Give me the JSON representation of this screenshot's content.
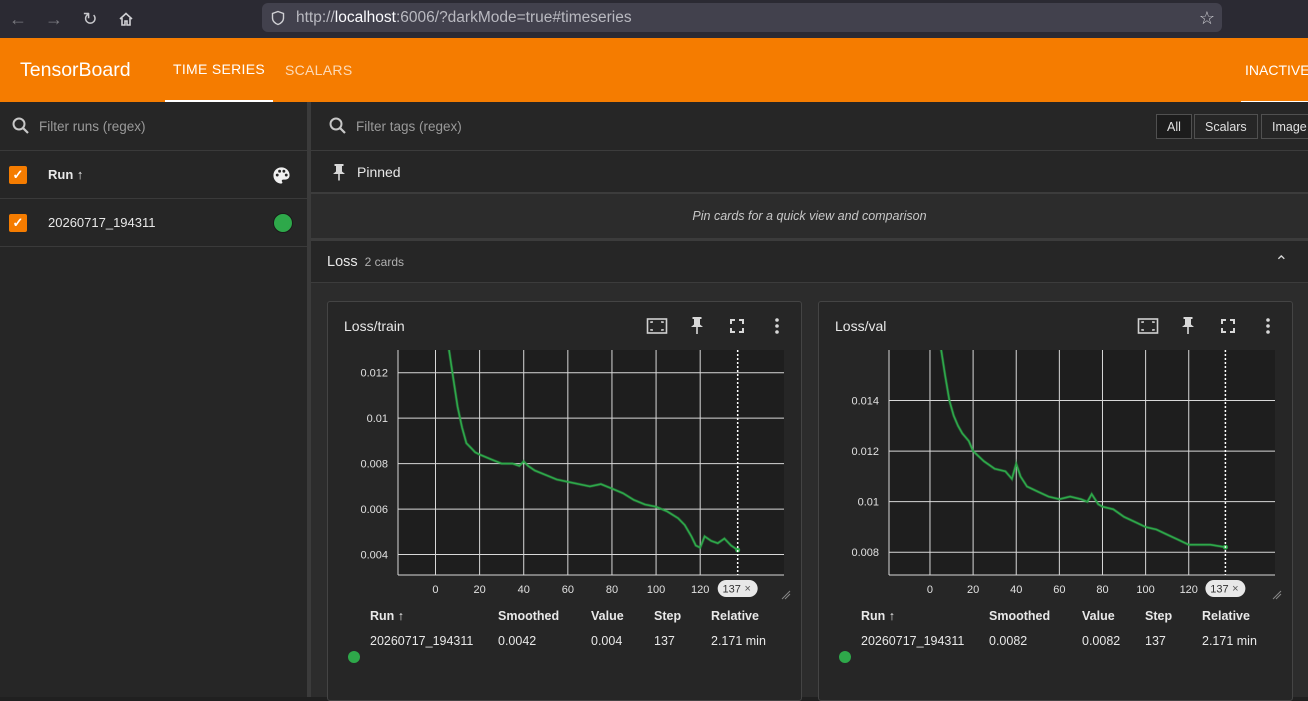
{
  "browser": {
    "url_scheme": "http://",
    "url_host": "localhost",
    "url_rest": ":6006/?darkMode=true#timeseries"
  },
  "header": {
    "logo": "TensorBoard",
    "tabs": [
      "TIME SERIES",
      "SCALARS"
    ],
    "status": "INACTIVE"
  },
  "sidebar": {
    "filter_placeholder": "Filter runs (regex)",
    "run_column": "Run ↑",
    "runs": [
      {
        "name": "20260717_194311",
        "color": "#2ea84a"
      }
    ]
  },
  "main": {
    "filter_placeholder": "Filter tags (regex)",
    "type_buttons": [
      "All",
      "Scalars",
      "Image"
    ],
    "pinned_title": "Pinned",
    "pinned_empty": "Pin cards for a quick view and comparison",
    "group_title": "Loss",
    "group_count": "2 cards"
  },
  "table_headers": {
    "run": "Run ↑",
    "smoothed": "Smoothed",
    "value": "Value",
    "step": "Step",
    "relative": "Relative"
  },
  "cards": [
    {
      "title": "Loss/train",
      "run": "20260717_194311",
      "smoothed": "0.0042",
      "value": "0.004",
      "step": "137",
      "relative": "2.171 min"
    },
    {
      "title": "Loss/val",
      "run": "20260717_194311",
      "smoothed": "0.0082",
      "value": "0.0082",
      "step": "137",
      "relative": "2.171 min"
    }
  ],
  "chart_data": [
    {
      "type": "line",
      "title": "Loss/train",
      "xlabel": "",
      "ylabel": "",
      "x_ticks": [
        "0",
        "20",
        "40",
        "60",
        "80",
        "100",
        "120"
      ],
      "y_ticks": [
        "0.004",
        "0.006",
        "0.008",
        "0.01",
        "0.012"
      ],
      "xlim": [
        -17,
        158
      ],
      "ylim": [
        0.0031,
        0.013
      ],
      "cursor_step": "137",
      "grid": true,
      "series": [
        {
          "name": "20260717_194311",
          "color": "#2ea84a",
          "x": [
            6,
            8,
            10,
            12,
            14,
            16,
            18,
            20,
            25,
            30,
            35,
            38,
            40,
            42,
            45,
            50,
            55,
            60,
            65,
            70,
            75,
            80,
            85,
            90,
            95,
            100,
            105,
            110,
            113,
            116,
            118,
            120,
            122,
            125,
            128,
            131,
            134,
            137
          ],
          "y": [
            0.0131,
            0.0118,
            0.0105,
            0.0096,
            0.0089,
            0.0087,
            0.0085,
            0.0084,
            0.0082,
            0.008,
            0.008,
            0.0079,
            0.0081,
            0.0079,
            0.0077,
            0.0075,
            0.0073,
            0.0072,
            0.0071,
            0.007,
            0.0071,
            0.0069,
            0.0067,
            0.0064,
            0.0062,
            0.0061,
            0.0059,
            0.0056,
            0.0053,
            0.0048,
            0.0044,
            0.0043,
            0.0048,
            0.0046,
            0.0045,
            0.0047,
            0.0044,
            0.0042
          ]
        }
      ]
    },
    {
      "type": "line",
      "title": "Loss/val",
      "xlabel": "",
      "ylabel": "",
      "x_ticks": [
        "0",
        "20",
        "40",
        "60",
        "80",
        "100",
        "120"
      ],
      "y_ticks": [
        "0.008",
        "0.01",
        "0.012",
        "0.014"
      ],
      "xlim": [
        -19,
        160
      ],
      "ylim": [
        0.0071,
        0.016
      ],
      "cursor_step": "137",
      "grid": true,
      "series": [
        {
          "name": "20260717_194311",
          "color": "#2ea84a",
          "x": [
            5,
            7,
            9,
            11,
            13,
            15,
            18,
            20,
            25,
            30,
            35,
            38,
            40,
            42,
            45,
            50,
            55,
            60,
            65,
            70,
            73,
            75,
            78,
            80,
            85,
            90,
            95,
            100,
            105,
            110,
            115,
            120,
            125,
            130,
            137
          ],
          "y": [
            0.0161,
            0.015,
            0.014,
            0.0134,
            0.013,
            0.0127,
            0.0124,
            0.012,
            0.0116,
            0.0113,
            0.0112,
            0.0109,
            0.0115,
            0.011,
            0.0106,
            0.0104,
            0.0102,
            0.0101,
            0.0102,
            0.0101,
            0.01,
            0.0103,
            0.0099,
            0.0098,
            0.0097,
            0.0094,
            0.0092,
            0.009,
            0.0089,
            0.0087,
            0.0085,
            0.0083,
            0.0083,
            0.0083,
            0.0082
          ]
        }
      ]
    }
  ]
}
